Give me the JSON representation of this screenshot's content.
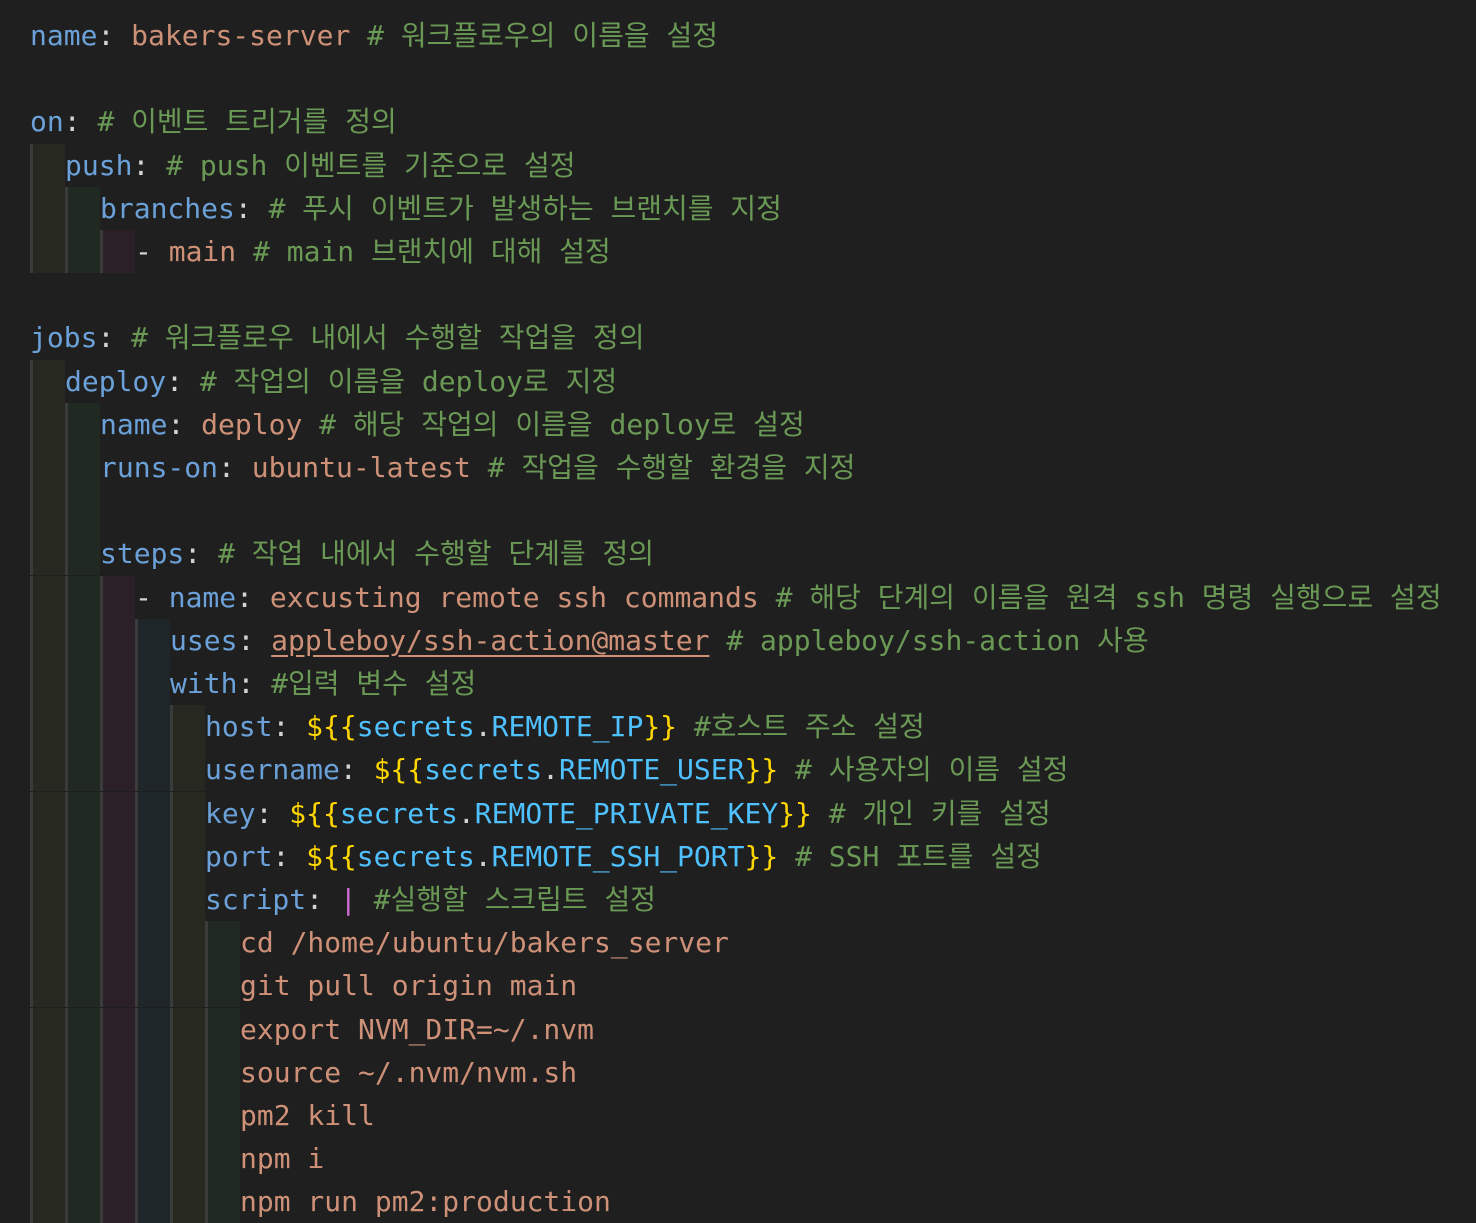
{
  "editor": {
    "language": "yaml",
    "theme_colors": {
      "background": "#1f1f1f",
      "key": "#6ba1d8",
      "string": "#ce9178",
      "comment": "#6a9955",
      "variable": "#4fc1ff",
      "bracket": "#ffd700",
      "pipe": "#d16bd6"
    },
    "lines": [
      {
        "indent": 0,
        "tokens": [
          {
            "t": "k",
            "v": "name"
          },
          {
            "t": "p",
            "v": ": "
          },
          {
            "t": "s",
            "v": "bakers-server "
          },
          {
            "t": "c",
            "v": "# 워크플로우의 이름을 설정"
          }
        ]
      },
      {
        "indent": 0,
        "tokens": []
      },
      {
        "indent": 0,
        "tokens": [
          {
            "t": "k",
            "v": "on"
          },
          {
            "t": "p",
            "v": ": "
          },
          {
            "t": "c",
            "v": "# 이벤트 트리거를 정의"
          }
        ]
      },
      {
        "indent": 1,
        "tokens": [
          {
            "t": "k",
            "v": "push"
          },
          {
            "t": "p",
            "v": ": "
          },
          {
            "t": "c",
            "v": "# push 이벤트를 기준으로 설정"
          }
        ]
      },
      {
        "indent": 2,
        "tokens": [
          {
            "t": "k",
            "v": "branches"
          },
          {
            "t": "p",
            "v": ": "
          },
          {
            "t": "c",
            "v": "# 푸시 이벤트가 발생하는 브랜치를 지정"
          }
        ]
      },
      {
        "indent": 3,
        "tokens": [
          {
            "t": "p",
            "v": "- "
          },
          {
            "t": "s",
            "v": "main "
          },
          {
            "t": "c",
            "v": "# main 브랜치에 대해 설정"
          }
        ]
      },
      {
        "indent": 0,
        "tokens": []
      },
      {
        "indent": 0,
        "tokens": [
          {
            "t": "k",
            "v": "jobs"
          },
          {
            "t": "p",
            "v": ": "
          },
          {
            "t": "c",
            "v": "# 워크플로우 내에서 수행할 작업을 정의"
          }
        ]
      },
      {
        "indent": 1,
        "tokens": [
          {
            "t": "k",
            "v": "deploy"
          },
          {
            "t": "p",
            "v": ": "
          },
          {
            "t": "c",
            "v": "# 작업의 이름을 deploy로 지정"
          }
        ]
      },
      {
        "indent": 2,
        "tokens": [
          {
            "t": "k",
            "v": "name"
          },
          {
            "t": "p",
            "v": ": "
          },
          {
            "t": "s",
            "v": "deploy "
          },
          {
            "t": "c",
            "v": "# 해당 작업의 이름을 deploy로 설정"
          }
        ]
      },
      {
        "indent": 2,
        "tokens": [
          {
            "t": "k",
            "v": "runs-on"
          },
          {
            "t": "p",
            "v": ": "
          },
          {
            "t": "s",
            "v": "ubuntu-latest "
          },
          {
            "t": "c",
            "v": "# 작업을 수행할 환경을 지정"
          }
        ]
      },
      {
        "indent": 2,
        "blank_guides": true,
        "tokens": []
      },
      {
        "indent": 2,
        "tokens": [
          {
            "t": "k",
            "v": "steps"
          },
          {
            "t": "p",
            "v": ": "
          },
          {
            "t": "c",
            "v": "# 작업 내에서 수행할 단계를 정의"
          }
        ]
      },
      {
        "indent": 3,
        "tokens": [
          {
            "t": "p",
            "v": "- "
          },
          {
            "t": "k",
            "v": "name"
          },
          {
            "t": "p",
            "v": ": "
          },
          {
            "t": "s",
            "v": "excusting remote ssh commands "
          },
          {
            "t": "c",
            "v": "# 해당 단계의 이름을 원격 ssh 명령 실행으로 설정"
          }
        ]
      },
      {
        "indent": 4,
        "tokens": [
          {
            "t": "k",
            "v": "uses"
          },
          {
            "t": "p",
            "v": ": "
          },
          {
            "t": "su",
            "v": "appleboy/ssh-action@master"
          },
          {
            "t": "p",
            "v": " "
          },
          {
            "t": "c",
            "v": "# appleboy/ssh-action 사용"
          }
        ]
      },
      {
        "indent": 4,
        "tokens": [
          {
            "t": "k",
            "v": "with"
          },
          {
            "t": "p",
            "v": ": "
          },
          {
            "t": "c",
            "v": "#입력 변수 설정"
          }
        ]
      },
      {
        "indent": 5,
        "tokens": [
          {
            "t": "k",
            "v": "host"
          },
          {
            "t": "p",
            "v": ": "
          },
          {
            "t": "b",
            "v": "${{"
          },
          {
            "t": "v",
            "v": "secrets"
          },
          {
            "t": "p",
            "v": "."
          },
          {
            "t": "v",
            "v": "REMOTE_IP"
          },
          {
            "t": "b",
            "v": "}}"
          },
          {
            "t": "p",
            "v": " "
          },
          {
            "t": "c",
            "v": "#호스트 주소 설정"
          }
        ]
      },
      {
        "indent": 5,
        "tokens": [
          {
            "t": "k",
            "v": "username"
          },
          {
            "t": "p",
            "v": ": "
          },
          {
            "t": "b",
            "v": "${{"
          },
          {
            "t": "v",
            "v": "secrets"
          },
          {
            "t": "p",
            "v": "."
          },
          {
            "t": "v",
            "v": "REMOTE_USER"
          },
          {
            "t": "b",
            "v": "}}"
          },
          {
            "t": "p",
            "v": " "
          },
          {
            "t": "c",
            "v": "# 사용자의 이름 설정"
          }
        ]
      },
      {
        "indent": 5,
        "tokens": [
          {
            "t": "k",
            "v": "key"
          },
          {
            "t": "p",
            "v": ": "
          },
          {
            "t": "b",
            "v": "${{"
          },
          {
            "t": "v",
            "v": "secrets"
          },
          {
            "t": "p",
            "v": "."
          },
          {
            "t": "v",
            "v": "REMOTE_PRIVATE_KEY"
          },
          {
            "t": "b",
            "v": "}}"
          },
          {
            "t": "p",
            "v": " "
          },
          {
            "t": "c",
            "v": "# 개인 키를 설정"
          }
        ]
      },
      {
        "indent": 5,
        "tokens": [
          {
            "t": "k",
            "v": "port"
          },
          {
            "t": "p",
            "v": ": "
          },
          {
            "t": "b",
            "v": "${{"
          },
          {
            "t": "v",
            "v": "secrets"
          },
          {
            "t": "p",
            "v": "."
          },
          {
            "t": "v",
            "v": "REMOTE_SSH_PORT"
          },
          {
            "t": "b",
            "v": "}}"
          },
          {
            "t": "p",
            "v": " "
          },
          {
            "t": "c",
            "v": "# SSH 포트를 설정"
          }
        ]
      },
      {
        "indent": 5,
        "tokens": [
          {
            "t": "k",
            "v": "script"
          },
          {
            "t": "p",
            "v": ": "
          },
          {
            "t": "pp",
            "v": "|"
          },
          {
            "t": "p",
            "v": " "
          },
          {
            "t": "c",
            "v": "#실행할 스크립트 설정"
          }
        ]
      },
      {
        "indent": 6,
        "tokens": [
          {
            "t": "s",
            "v": "cd /home/ubuntu/bakers_server"
          }
        ]
      },
      {
        "indent": 6,
        "tokens": [
          {
            "t": "s",
            "v": "git pull origin main"
          }
        ]
      },
      {
        "indent": 6,
        "tokens": [
          {
            "t": "s",
            "v": "export NVM_DIR=~/.nvm"
          }
        ]
      },
      {
        "indent": 6,
        "tokens": [
          {
            "t": "s",
            "v": "source ~/.nvm/nvm.sh"
          }
        ]
      },
      {
        "indent": 6,
        "tokens": [
          {
            "t": "s",
            "v": "pm2 kill"
          }
        ]
      },
      {
        "indent": 6,
        "tokens": [
          {
            "t": "s",
            "v": "npm i"
          }
        ]
      },
      {
        "indent": 6,
        "tokens": [
          {
            "t": "s",
            "v": "npm run pm2:production"
          }
        ]
      }
    ]
  }
}
